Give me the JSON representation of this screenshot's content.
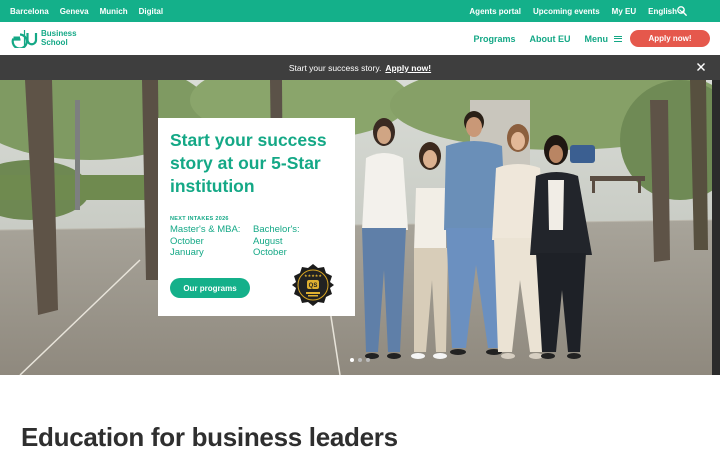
{
  "topbar": {
    "campuses": [
      "Barcelona",
      "Geneva",
      "Munich",
      "Digital"
    ],
    "links": [
      "Agents portal",
      "Upcoming events",
      "My EU"
    ],
    "language": "English"
  },
  "header": {
    "logo_line1": "Business",
    "logo_line2": "School",
    "nav": {
      "programs": "Programs",
      "about": "About EU",
      "menu": "Menu"
    },
    "apply_label": "Apply now!"
  },
  "banner": {
    "text": "Start your success story.",
    "cta": "Apply now!"
  },
  "hero": {
    "headline": "Start your success story at our 5-Star institution",
    "intake_title": "NEXT INTAKES 2026",
    "intakes": [
      {
        "program": "Master's & MBA:",
        "dates": [
          "October",
          "January"
        ]
      },
      {
        "program": "Bachelor's:",
        "dates": [
          "August",
          "October"
        ]
      }
    ],
    "button_label": "Our programs",
    "badge_text": "QS",
    "slides": 3,
    "active_slide": 0
  },
  "section": {
    "title": "Education for business leaders"
  },
  "colors": {
    "brand_green": "#14b08a",
    "brand_text_green": "#14a886",
    "accent_red": "#e5584c",
    "banner_bg": "#3e3e3e"
  }
}
